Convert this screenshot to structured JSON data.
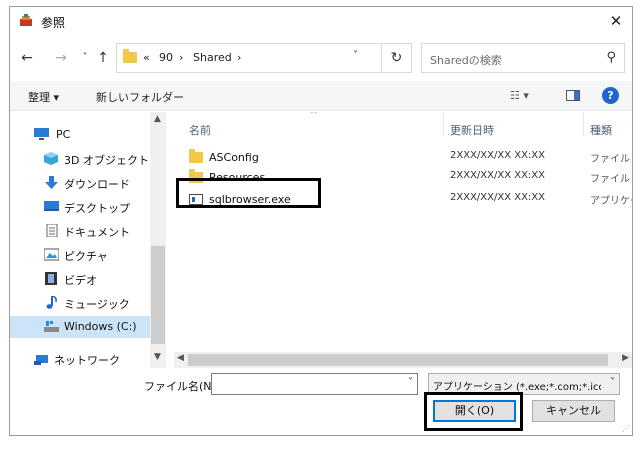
{
  "window": {
    "title": "参照",
    "close_glyph": "✕"
  },
  "nav": {
    "back_glyph": "←",
    "forward_glyph": "→",
    "recent_glyph": "˅",
    "up_glyph": "↑"
  },
  "address": {
    "overflow": "«",
    "crumbs": [
      "90",
      "Shared"
    ],
    "separator": "›"
  },
  "search": {
    "placeholder": "Sharedの検索"
  },
  "toolbar": {
    "organize_label": "整理 ▾",
    "new_folder_label": "新しいフォルダー"
  },
  "sidebar": {
    "items": [
      {
        "label": "PC",
        "icon": "pc-icon"
      },
      {
        "label": "3D オブジェクト",
        "icon": "3d-objects-icon"
      },
      {
        "label": "ダウンロード",
        "icon": "download-icon"
      },
      {
        "label": "デスクトップ",
        "icon": "desktop-icon"
      },
      {
        "label": "ドキュメント",
        "icon": "documents-icon"
      },
      {
        "label": "ピクチャ",
        "icon": "pictures-icon"
      },
      {
        "label": "ビデオ",
        "icon": "videos-icon"
      },
      {
        "label": "ミュージック",
        "icon": "music-icon"
      },
      {
        "label": "Windows (C:)",
        "icon": "drive-icon",
        "selected": true
      },
      {
        "label": "ネットワーク",
        "icon": "network-icon"
      }
    ]
  },
  "file_list": {
    "columns": [
      "名前",
      "更新日時",
      "種類"
    ],
    "rows": [
      {
        "name": "ASConfig",
        "date": "2XXX/XX/XX XX:XX",
        "type": "ファイル フォルダー",
        "icon": "folder-icon"
      },
      {
        "name": "Resources",
        "date": "2XXX/XX/XX XX:XX",
        "type": "ファイル フォルダー",
        "icon": "folder-icon"
      },
      {
        "name": "sqlbrowser.exe",
        "date": "2XXX/XX/XX XX:XX",
        "type": "アプリケーション",
        "icon": "exe-icon"
      }
    ]
  },
  "footer": {
    "filename_label": "ファイル名(N):",
    "filename_value": "",
    "filetype_value": "アプリケーション (*.exe;*.com;*.icd",
    "open_label": "開く(O)",
    "cancel_label": "キャンセル"
  },
  "colors": {
    "accent": "#0078d7",
    "selection": "#cce4f7",
    "folder": "#f2c84b"
  }
}
